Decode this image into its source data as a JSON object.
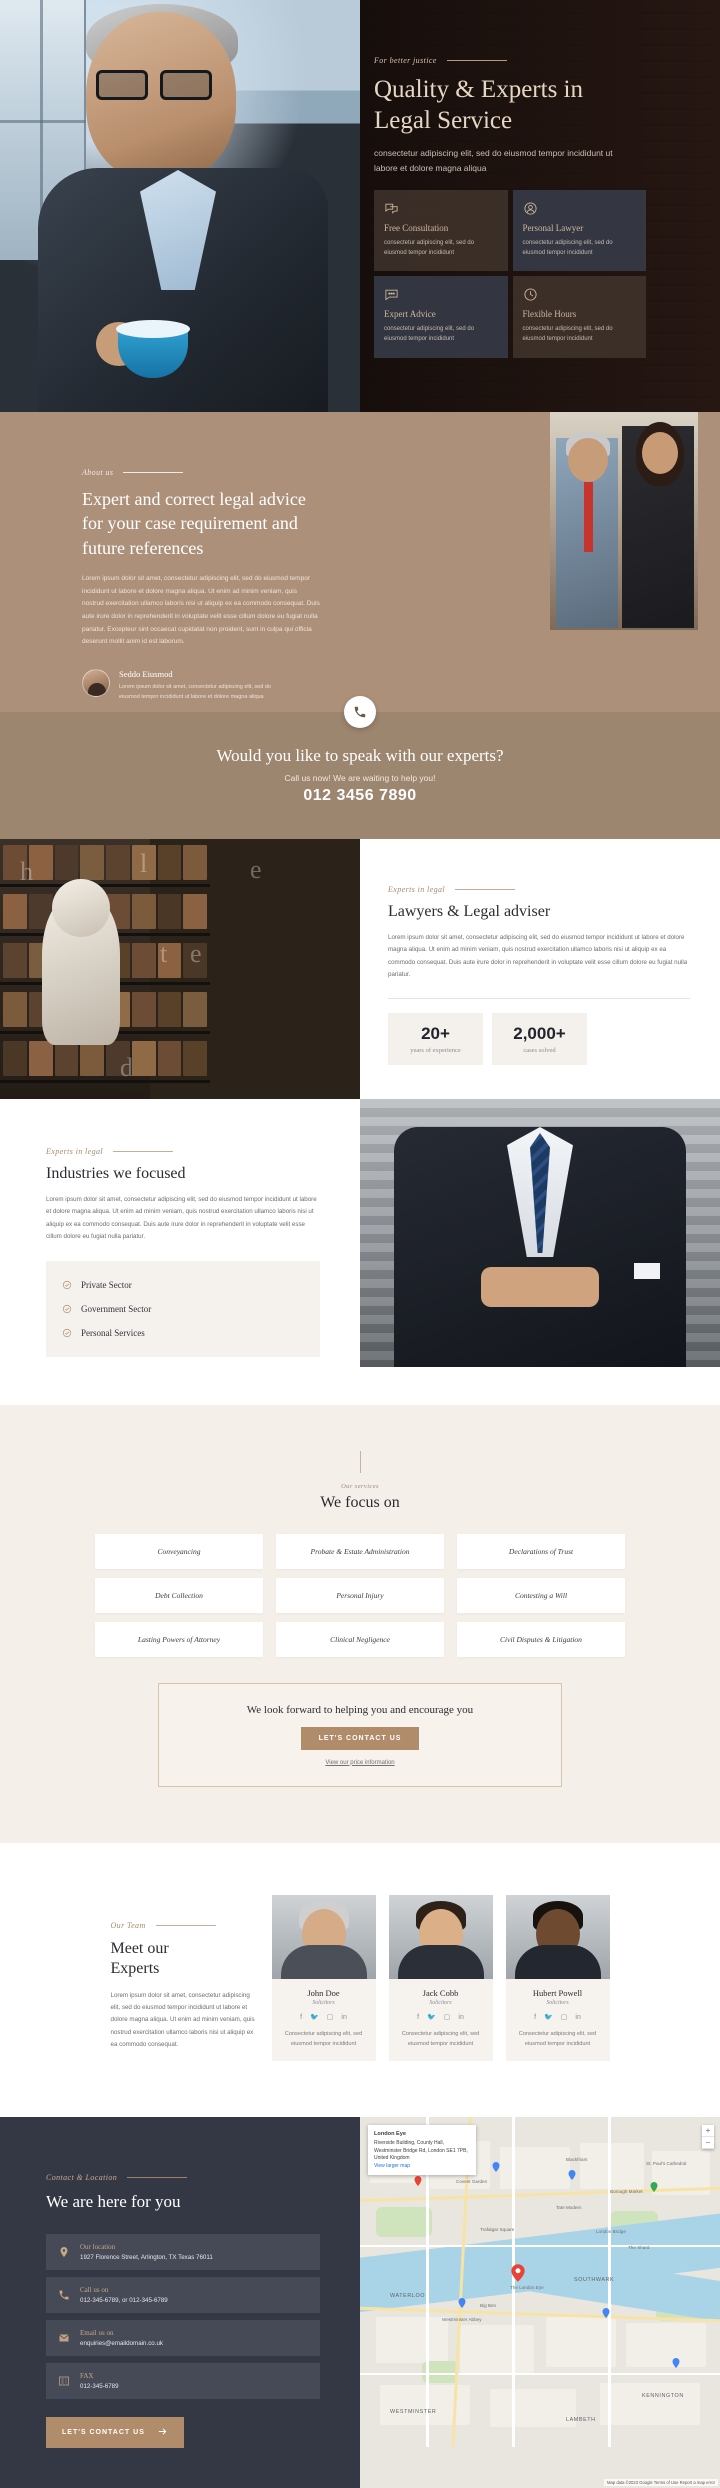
{
  "hero": {
    "eyebrow": "For better justice",
    "title_line1": "Quality & Experts in",
    "title_line2": "Legal Service",
    "subtitle": "consectetur adipiscing elit, sed do eiusmod tempor incididunt ut labore et dolore magna aliqua",
    "cards": [
      {
        "icon": "chat-bubbles-icon",
        "title": "Free Consultation",
        "text": "consectetur adipiscing elit, sed do eiusmod tempor incididunt"
      },
      {
        "icon": "user-circle-icon",
        "title": "Personal Lawyer",
        "text": "consectetur adipiscing elit, sed do eiusmod tempor incididunt"
      },
      {
        "icon": "chat-dots-icon",
        "title": "Expert Advice",
        "text": "consectetur adipiscing elit, sed do eiusmod tempor incididunt"
      },
      {
        "icon": "clock-icon",
        "title": "Flexible Hours",
        "text": "consectetur adipiscing elit, sed do eiusmod tempor incididunt"
      }
    ]
  },
  "about": {
    "eyebrow": "About us",
    "heading": "Expert and correct legal advice for your case requirement and future references",
    "paragraph": "Lorem ipsum dolor sit amet, consectetur adipiscing elit, sed do eiusmod tempor incididunt ut labore et dolore magna aliqua. Ut enim ad minim veniam, quis nostrud exercitation ullamco laboris nisi ut aliquip ex ea commodo consequat. Duis aute irure dolor in reprehenderit in voluptate velit esse cillum dolore eu fugiat nulla pariatur. Excepteur sint occaecat cupidatat non proident, sunt in culpa qui officia deserunt mollit anim id est laborum.",
    "signature_name": "Seddo Eiusmod",
    "signature_text": "Lorem ipsum dolor sit amet, consectetur adipiscing elit, sed do eiusmod tempor incididunt ut labore et dolore magna aliqua"
  },
  "cta_band": {
    "icon": "phone-icon",
    "heading": "Would you like to speak with our experts?",
    "subtext": "Call us now! We are waiting to help you!",
    "phone": "012 3456 7890"
  },
  "lawyers": {
    "eyebrow": "Experts in legal",
    "heading": "Lawyers & Legal adviser",
    "paragraph": "Lorem ipsum dolor sit amet, consectetur adipiscing elit, sed do eiusmod tempor incididunt ut labore et dolore magna aliqua. Ut enim ad minim veniam, quis nostrud exercitation ullamco laboris nisi ut aliquip ex ea commodo consequat. Duis aute irure dolor in reprehenderit in voluptate velit esse cillum dolore eu fugiat nulla pariatur.",
    "stats": [
      {
        "value": "20+",
        "label": "years of experience"
      },
      {
        "value": "2,000+",
        "label": "cases solved"
      }
    ]
  },
  "industries": {
    "eyebrow": "Experts in legal",
    "heading": "Industries we focused",
    "paragraph": "Lorem ipsum dolor sit amet, consectetur adipiscing elit, sed do eiusmod tempor incididunt ut labore et dolore magna aliqua. Ut enim ad minim veniam, quis nostrud exercitation ullamco laboris nisi ut aliquip ex ea commodo consequat. Duis aute irure dolor in reprehenderit in voluptate velit esse cillum dolore eu fugiat nulla pariatur.",
    "items": [
      "Private Sector",
      "Government Sector",
      "Personal Services"
    ]
  },
  "focus": {
    "eyebrow": "Our services",
    "heading": "We focus on",
    "services": [
      "Conveyancing",
      "Probate & Estate Administration",
      "Declarations of Trust",
      "Debt Collection",
      "Personal Injury",
      "Contesting a Will",
      "Lasting Powers of Attorney",
      "Clinical Negligence",
      "Civil Disputes & Litigation"
    ],
    "cta_heading": "We look forward to helping you and encourage you",
    "cta_button": "LET'S CONTACT US",
    "cta_link": "View our price information"
  },
  "team": {
    "eyebrow": "Our Team",
    "heading_line1": "Meet our",
    "heading_line2": "Experts",
    "paragraph": "Lorem ipsum dolor sit amet, consectetur adipiscing elit, sed do eiusmod tempor incididunt ut labore et dolore magna aliqua. Ut enim ad minim veniam, quis nostrud exercitation ullamco laboris nisi ut aliquip ex ea commodo consequat.",
    "members": [
      {
        "name": "John Doe",
        "role": "Solicitors",
        "desc": "Consectetur adipiscing elit, sed eiusmod tempor incididunt"
      },
      {
        "name": "Jack Cobb",
        "role": "Solicitors",
        "desc": "Consectetur adipiscing elit, sed eiusmod tempor incididunt"
      },
      {
        "name": "Hubert Powell",
        "role": "Solicitors",
        "desc": "Consectetur adipiscing elit, sed eiusmod tempor incididunt"
      }
    ],
    "socials": [
      "facebook-icon",
      "twitter-icon",
      "instagram-icon",
      "linkedin-icon"
    ]
  },
  "contact": {
    "eyebrow": "Contact & Location",
    "heading": "We are here for you",
    "rows": [
      {
        "icon": "map-pin-icon",
        "label": "Our location",
        "value": "1927 Florence Street, Arlington, TX Texas 76011"
      },
      {
        "icon": "phone-icon",
        "label": "Call us on",
        "value": "012-345-6789, or 012-345-6789"
      },
      {
        "icon": "envelope-icon",
        "label": "Email us on",
        "value": "enquiries@emaildomain.co.uk"
      },
      {
        "icon": "fax-icon",
        "label": "FAX",
        "value": "012-345-6789"
      }
    ],
    "button": "LET'S CONTACT US",
    "button_icon": "arrow-right-icon"
  },
  "map": {
    "info_title": "London Eye",
    "info_lines": "Riverside Building, County Hall, Westminster Bridge Rd, London SE1 7PB, United Kingdom",
    "info_link": "View larger map",
    "labels": [
      "WATERLOO",
      "SOUTHWARK",
      "LAMBETH",
      "WESTMINSTER",
      "KENNINGTON",
      "The Shard",
      "London Bridge",
      "Tate Modern",
      "Borough Market",
      "The London Eye",
      "Westminster Abbey",
      "Big Ben",
      "Covent Garden",
      "Trafalgar Square",
      "St. Paul's Cathedral",
      "Blackfriars"
    ],
    "attribution": "Map data ©2023 Google  Terms of Use  Report a map error",
    "zoom_in": "+",
    "zoom_out": "−"
  },
  "colors": {
    "accent": "#b08c6b",
    "about_bg": "#ad907a",
    "cta_band_bg": "#9d8670",
    "dark_bg": "#343844",
    "focus_bg": "#f4efe9"
  }
}
